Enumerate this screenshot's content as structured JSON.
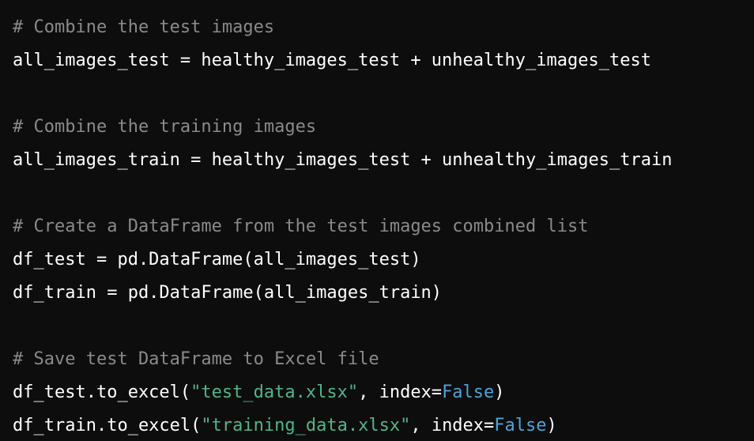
{
  "theme": {
    "background": "#0d0d0d",
    "text": "#ffffff",
    "comment": "#8a8a8a",
    "string": "#4fb58d",
    "keyword": "#4ea3d8"
  },
  "code": {
    "lines": [
      {
        "tokens": [
          {
            "type": "comment",
            "text": "# Combine the test images"
          }
        ]
      },
      {
        "tokens": [
          {
            "type": "plain",
            "text": "all_images_test = healthy_images_test + unhealthy_images_test"
          }
        ]
      },
      {
        "tokens": []
      },
      {
        "tokens": [
          {
            "type": "comment",
            "text": "# Combine the training images"
          }
        ]
      },
      {
        "tokens": [
          {
            "type": "plain",
            "text": "all_images_train = healthy_images_test + unhealthy_images_train"
          }
        ]
      },
      {
        "tokens": []
      },
      {
        "tokens": [
          {
            "type": "comment",
            "text": "# Create a DataFrame from the test images combined list"
          }
        ]
      },
      {
        "tokens": [
          {
            "type": "plain",
            "text": "df_test = pd.DataFrame(all_images_test)"
          }
        ]
      },
      {
        "tokens": [
          {
            "type": "plain",
            "text": "df_train = pd.DataFrame(all_images_train)"
          }
        ]
      },
      {
        "tokens": []
      },
      {
        "tokens": [
          {
            "type": "comment",
            "text": "# Save test DataFrame to Excel file"
          }
        ]
      },
      {
        "tokens": [
          {
            "type": "plain",
            "text": "df_test.to_excel("
          },
          {
            "type": "string",
            "text": "\"test_data.xlsx\""
          },
          {
            "type": "plain",
            "text": ", index="
          },
          {
            "type": "keyword",
            "text": "False"
          },
          {
            "type": "plain",
            "text": ")"
          }
        ]
      },
      {
        "tokens": [
          {
            "type": "plain",
            "text": "df_train.to_excel("
          },
          {
            "type": "string",
            "text": "\"training_data.xlsx\""
          },
          {
            "type": "plain",
            "text": ", index="
          },
          {
            "type": "keyword",
            "text": "False"
          },
          {
            "type": "plain",
            "text": ")"
          }
        ]
      }
    ]
  }
}
